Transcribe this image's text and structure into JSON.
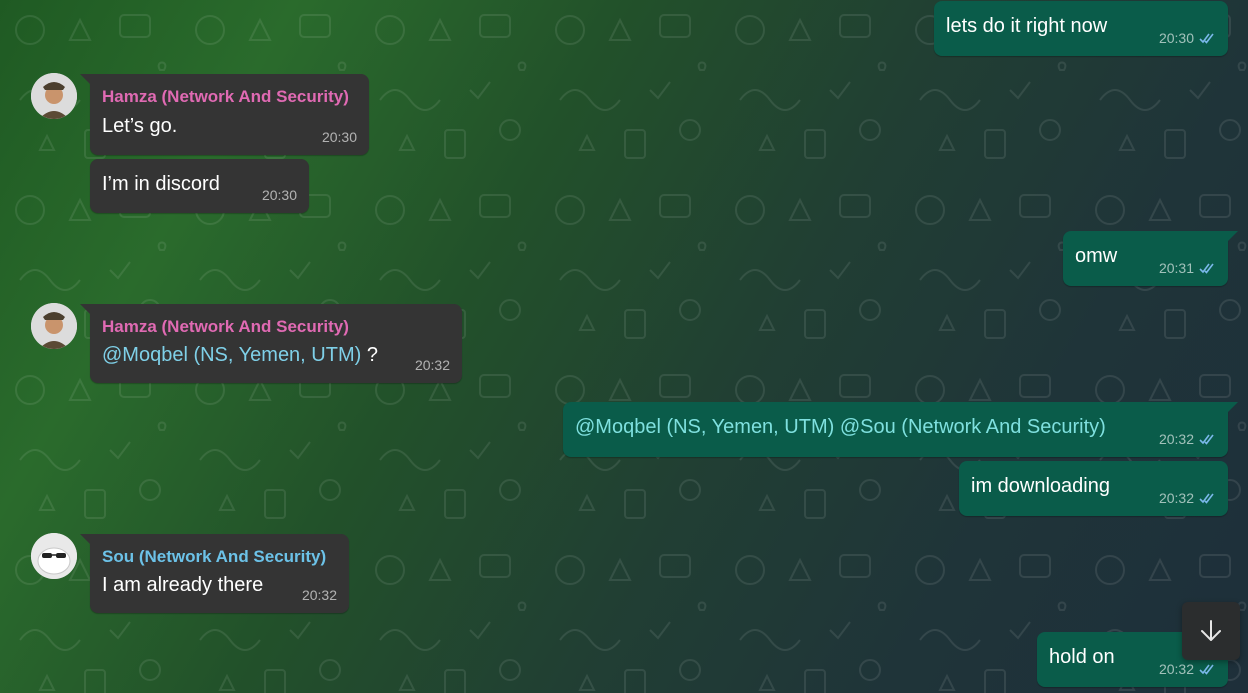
{
  "colors": {
    "incoming_bubble": "#343434",
    "outgoing_bubble": "#0a5c4a",
    "hamza_name": "#e06ab3",
    "sou_name": "#6cc2e8",
    "mention": "#7fd0e8",
    "read_check": "#7ab8ea"
  },
  "messages": [
    {
      "direction": "out",
      "text": "lets do it right now",
      "time": "20:30",
      "status_icon": "double-check-icon"
    },
    {
      "direction": "in",
      "sender": "Hamza (Network And Security)",
      "avatar_icon": "hamza-avatar",
      "text": "Let’s go.",
      "time": "20:30"
    },
    {
      "direction": "in",
      "text": "I’m in discord",
      "time": "20:30"
    },
    {
      "direction": "out",
      "text": "omw",
      "time": "20:31",
      "status_icon": "double-check-icon"
    },
    {
      "direction": "in",
      "sender": "Hamza (Network And Security)",
      "avatar_icon": "hamza-avatar",
      "mention": "@Moqbel (NS, Yemen, UTM)",
      "text_after": " ?",
      "time": "20:32"
    },
    {
      "direction": "out",
      "text": "@Moqbel (NS, Yemen, UTM) @Sou (Network And Security)",
      "time": "20:32",
      "status_icon": "double-check-icon"
    },
    {
      "direction": "out",
      "text": "im downloading",
      "time": "20:32",
      "status_icon": "double-check-icon"
    },
    {
      "direction": "in",
      "sender": "Sou (Network And Security)",
      "avatar_icon": "sou-avatar",
      "text": "I am already there",
      "time": "20:32"
    },
    {
      "direction": "out",
      "text": "hold on",
      "time": "20:32",
      "status_icon": "double-check-icon"
    }
  ],
  "scroll_button": {
    "icon": "arrow-down-icon"
  }
}
